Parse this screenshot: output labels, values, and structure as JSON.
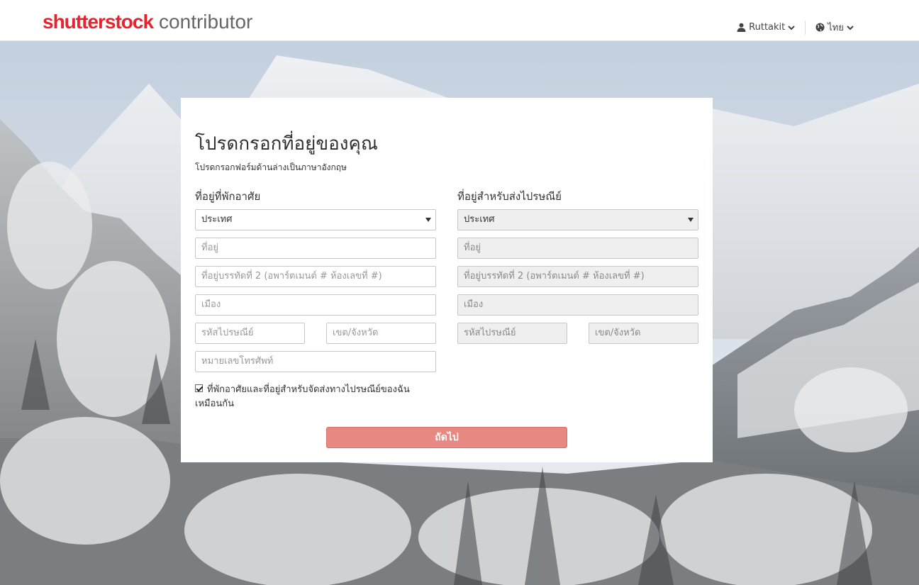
{
  "header": {
    "logo_brand": "shutterstock",
    "logo_sub": "contributor",
    "user_label": "Ruttakit",
    "language_label": "ไทย",
    "icons": [
      "user-icon",
      "chevron-down-icon",
      "globe-icon"
    ]
  },
  "form": {
    "title": "โปรดกรอกที่อยู่ของคุณ",
    "subtitle": "โปรดกรอกฟอร์มด้านล่างเป็นภาษาอังกฤษ",
    "residential": {
      "label": "ที่อยู่ที่พักอาศัย",
      "country_value": "ประเทศ",
      "address_placeholder": "ที่อยู่",
      "address2_placeholder": "ที่อยู่บรรทัดที่ 2 (อพาร์ตเมนต์ # ห้องเลขที่ #)",
      "city_placeholder": "เมือง",
      "postal_placeholder": "รหัสไปรษณีย์",
      "district_placeholder": "เขต/จังหวัด",
      "phone_placeholder": "หมายเลขโทรศัพท์"
    },
    "mailing": {
      "label": "ที่อยู่สำหรับส่งไปรษณีย์",
      "country_value": "ประเทศ",
      "address_placeholder": "ที่อยู่",
      "address2_placeholder": "ที่อยู่บรรทัดที่ 2 (อพาร์ตเมนต์ # ห้องเลขที่ #)",
      "city_placeholder": "เมือง",
      "postal_placeholder": "รหัสไปรษณีย์",
      "district_placeholder": "เขต/จังหวัด"
    },
    "same_address_checked": true,
    "same_address_label": "ที่พักอาศัยและที่อยู่สำหรับจัดส่งทางไปรษณีย์ของฉันเหมือนกัน",
    "next_button": "ถัดไป"
  },
  "colors": {
    "brand_red": "#e7232d",
    "button": "#e88883",
    "disabled_field": "#efefef"
  }
}
